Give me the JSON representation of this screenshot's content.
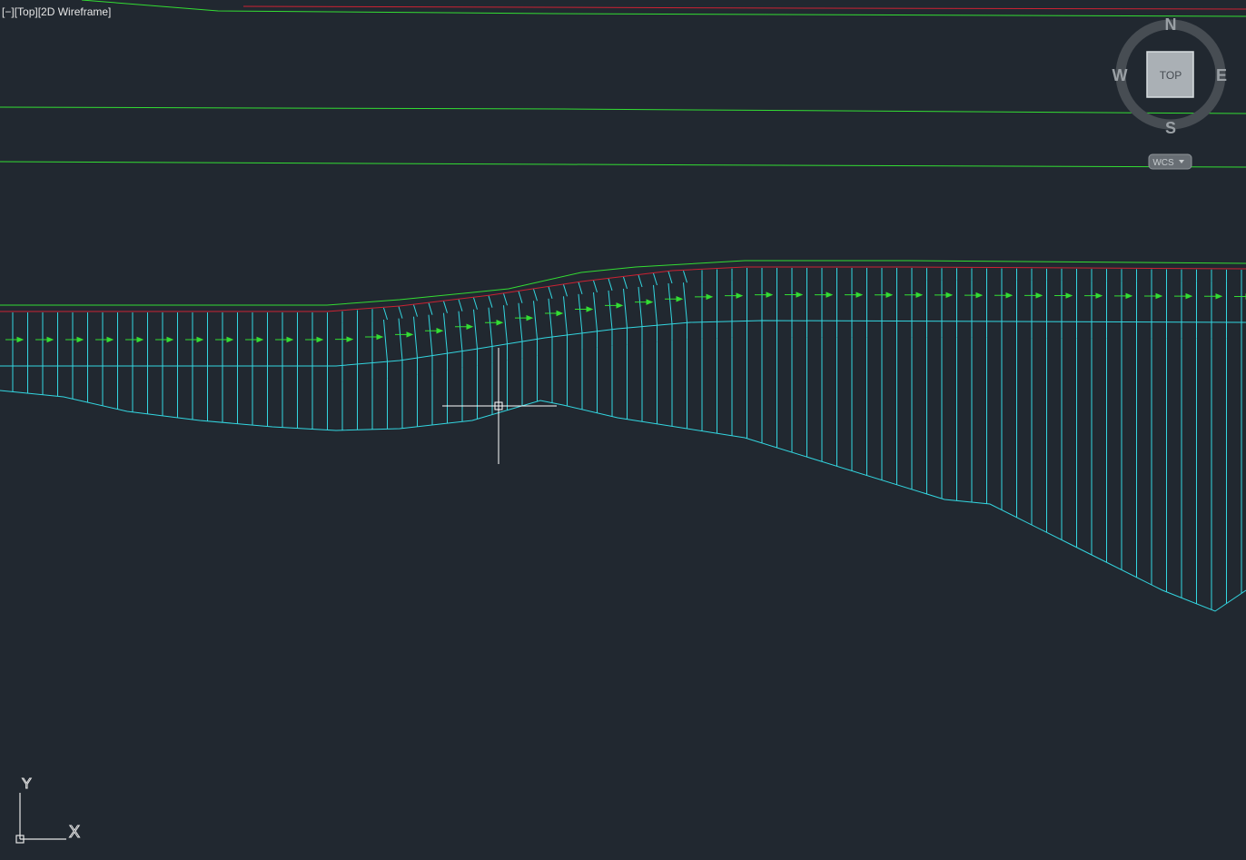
{
  "viewport_controls": {
    "menu": "[−]",
    "view": "[Top]",
    "visual_style": "[2D Wireframe]"
  },
  "viewcube": {
    "face": "TOP",
    "north": "N",
    "south": "S",
    "east": "E",
    "west": "W",
    "ucs_menu": "WCS"
  },
  "ucs_icon": {
    "x_label": "X",
    "y_label": "Y"
  },
  "colors": {
    "background": "#212830",
    "green_linework": "#33dd33",
    "red_linework": "#cc2233",
    "cyan_linework": "#33d6e0",
    "crosshair": "#ffffff"
  }
}
